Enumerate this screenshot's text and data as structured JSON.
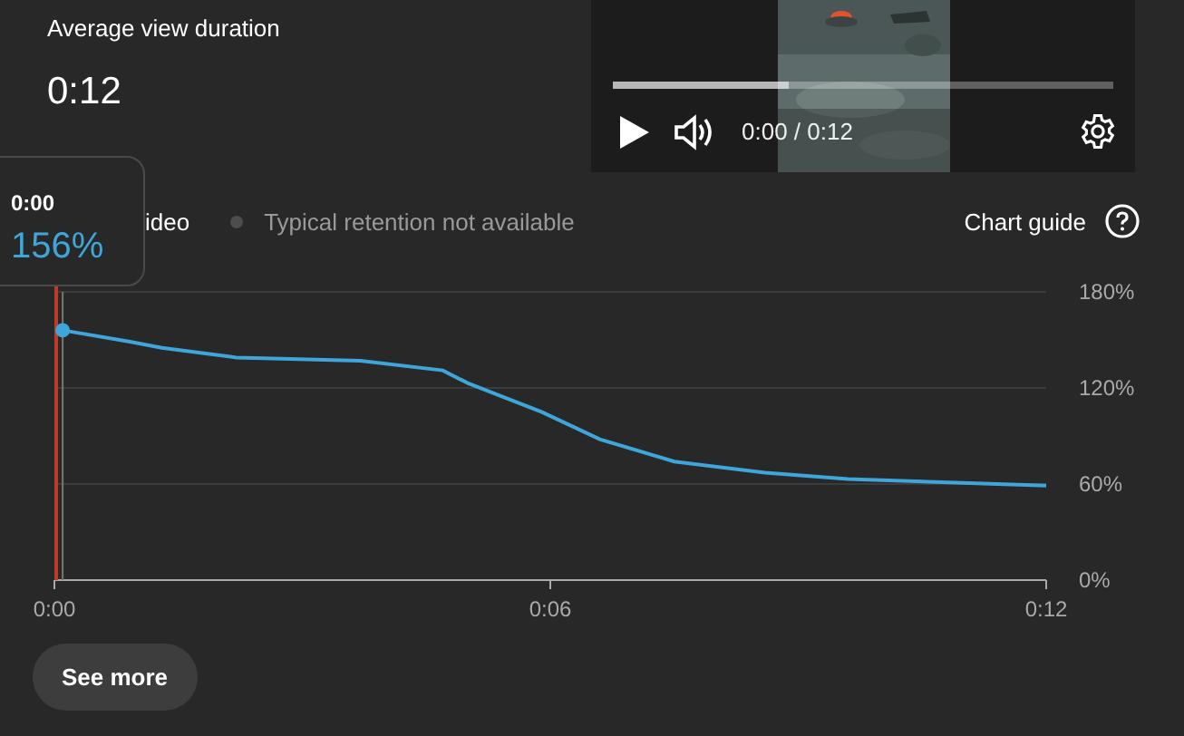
{
  "metric": {
    "label": "Average view duration",
    "value": "0:12"
  },
  "player": {
    "time": "0:00 / 0:12",
    "level": 0.35
  },
  "legend": [
    {
      "label": "ideo"
    },
    {
      "label": "Typical retention not available",
      "color": "#4d4d4d"
    }
  ],
  "chart_guide": "Chart guide",
  "chart_data": {
    "type": "line",
    "x": [
      0.1,
      0.9,
      1.3,
      2.2,
      3.7,
      4.7,
      5.0,
      5.9,
      6.6,
      7.5,
      8.6,
      9.6,
      12
    ],
    "series": [
      {
        "color": "#3ea6d9",
        "values": [
          156,
          149,
          145,
          139,
          137,
          131,
          123,
          105,
          88,
          74,
          67,
          63,
          59
        ]
      }
    ],
    "ref_lines": [
      {
        "axis": "x",
        "value": 0.1,
        "color": "#777777"
      },
      {
        "axis": "x",
        "value": 0,
        "color": "#c0392b"
      }
    ],
    "xlim": [
      0,
      12
    ],
    "ylim": [
      0,
      180
    ],
    "xticks": [
      {
        "value": 0,
        "label": "0:00"
      },
      {
        "value": 6,
        "label": "0:06"
      },
      {
        "value": 12,
        "label": "0:12"
      }
    ],
    "yticks": [
      {
        "value": 0,
        "label": "0%"
      },
      {
        "value": 60,
        "label": "60%"
      },
      {
        "value": 120,
        "label": "120%"
      },
      {
        "value": 180,
        "label": "180%"
      }
    ]
  },
  "tooltip": {
    "time": "0:00",
    "value": "156%"
  },
  "see_more": "See more"
}
